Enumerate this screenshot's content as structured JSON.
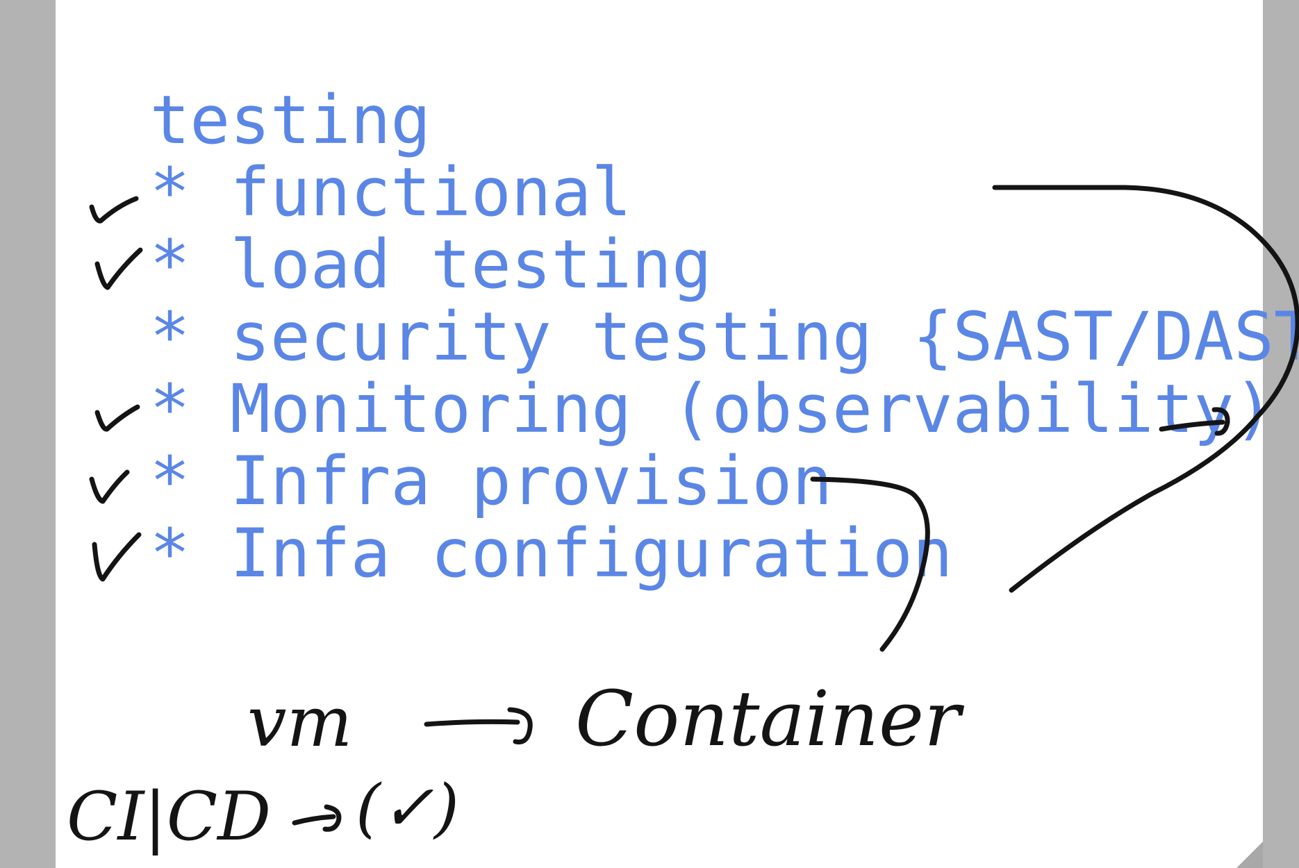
{
  "note": {
    "typed_lines": [
      "  testing",
      "  * functional",
      "  * load testing",
      "  * security testing {SAST/DAST}",
      "  * Monitoring (observability)",
      "  * Infra provision",
      "  * Infa configuration"
    ],
    "checked_lines": [
      1,
      2,
      4,
      5,
      6
    ],
    "handwriting": {
      "vm": "vm",
      "container": "Container",
      "cicd": "CI|CD",
      "cicd_mark": "(✓)"
    },
    "colors": {
      "typed_text": "#5a86e6",
      "ink": "#141414",
      "page": "#ffffff",
      "frame": "#b3b3b3"
    }
  }
}
